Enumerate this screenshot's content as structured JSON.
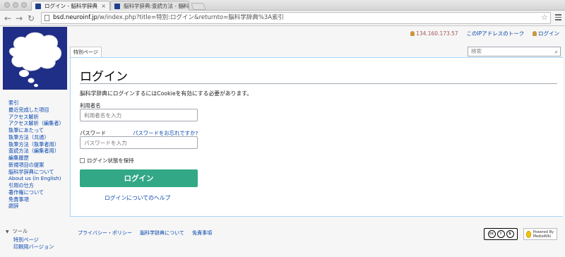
{
  "browser": {
    "tabs": [
      {
        "label": "ログイン - 脳科学辞典",
        "close": "×"
      },
      {
        "label": "脳科学辞典:査読方法 - 脳科学",
        "close": "×"
      }
    ],
    "nav": {
      "back": "←",
      "forward": "→",
      "reload": "↻"
    },
    "url_host": "bsd.neuroinf.jp",
    "url_path": "/w/index.php?title=特別:ログイン&returnto=脳科学辞典%3A索引",
    "star": "☆"
  },
  "personal": {
    "ip": "134.160.173.57",
    "talk": "このIPアドレスのトーク",
    "login": "ログイン"
  },
  "sidebar": {
    "items": [
      "索引",
      "最近完成した項目",
      "アクセス解析",
      "アクセス解析（編集者）",
      "執筆にあたって",
      "執筆方法（共通）",
      "執筆方法（執筆者用）",
      "査読方法（編集者用）",
      "編集履歴",
      "新規項目の提案",
      "脳科学辞典について",
      "About us (in English)",
      "引用の仕方",
      "著作権について",
      "免責事項",
      "謝辞"
    ],
    "tools_heading": "ツール",
    "tools_arrow": "▼",
    "tools": [
      "特別ページ",
      "印刷用バージョン"
    ]
  },
  "page_tab": "特別ページ",
  "search": {
    "placeholder": "検索",
    "icon": "search-icon"
  },
  "content": {
    "title": "ログイン",
    "cookie_notice": "脳科学辞典にログインするにはCookieを有効にする必要があります。",
    "username_label": "利用者名",
    "username_placeholder": "利用者名を入力",
    "password_label": "パスワード",
    "forgot_password": "パスワードをお忘れですか?",
    "password_placeholder": "パスワードを入力",
    "remember": "ログイン状態を保持",
    "login_button": "ログイン",
    "help": "ログインについてのヘルプ"
  },
  "footer": {
    "links": [
      "プライバシー・ポリシー",
      "脳科学辞典について",
      "免責事項"
    ],
    "cc_badge": "cc BY NC",
    "mediawiki_badge": "Powered By MediaWiki"
  },
  "colors": {
    "logo_bg": "#1f2e86",
    "login_button": "#32a886",
    "link": "#0645ad"
  }
}
